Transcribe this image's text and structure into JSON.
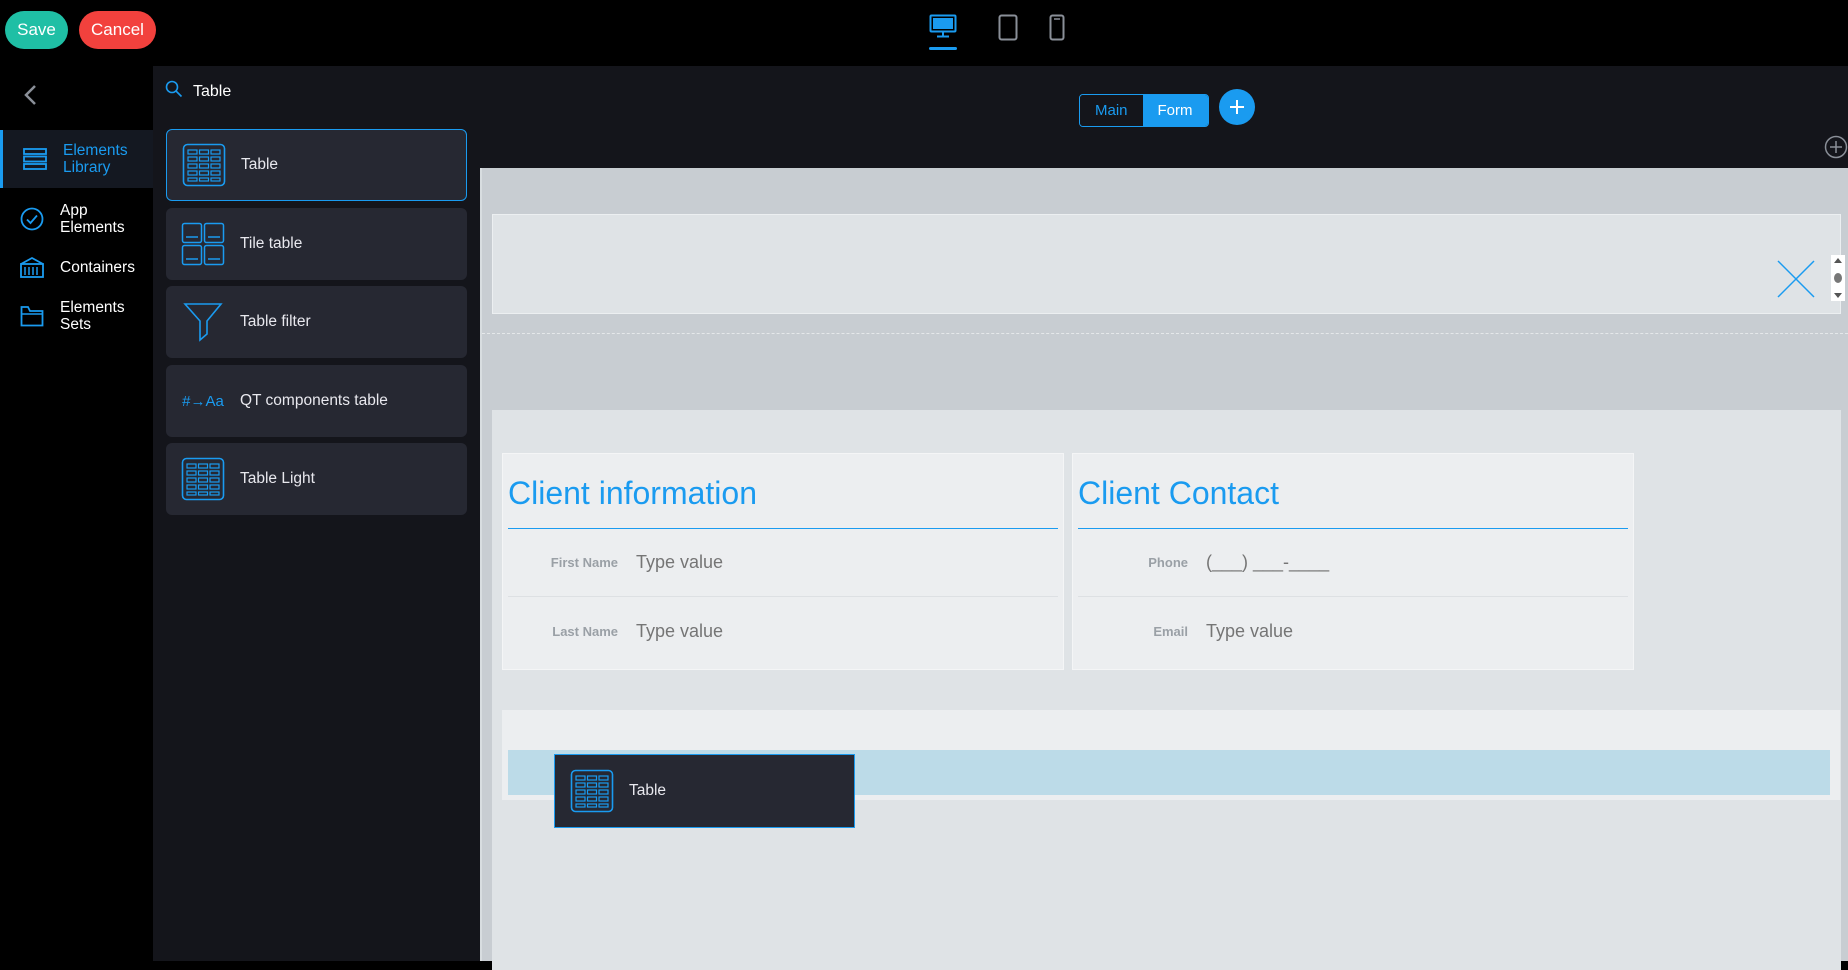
{
  "toolbar": {
    "save_label": "Save",
    "cancel_label": "Cancel"
  },
  "devices": [
    {
      "name": "desktop",
      "active": true
    },
    {
      "name": "tablet",
      "active": false
    },
    {
      "name": "phone",
      "active": false
    }
  ],
  "nav": {
    "items": [
      {
        "label": "Elements\nLibrary",
        "icon": "stack-icon",
        "active": true
      },
      {
        "label": "App\nElements",
        "icon": "check-circle-icon",
        "active": false
      },
      {
        "label": "Containers",
        "icon": "container-icon",
        "active": false
      },
      {
        "label": "Elements\nSets",
        "icon": "folder-icon",
        "active": false
      }
    ]
  },
  "library": {
    "search_value": "Table",
    "items": [
      {
        "label": "Table",
        "icon": "table-grid-icon",
        "selected": true
      },
      {
        "label": "Tile table",
        "icon": "tile-table-icon",
        "selected": false
      },
      {
        "label": "Table filter",
        "icon": "filter-icon",
        "selected": false
      },
      {
        "label": "QT components table",
        "icon": "hash-to-text-icon",
        "selected": false
      },
      {
        "label": "Table Light",
        "icon": "table-grid-icon",
        "selected": false
      }
    ]
  },
  "canvas": {
    "tabs": [
      {
        "label": "Main",
        "active": false
      },
      {
        "label": "Form",
        "active": true
      }
    ],
    "cards": [
      {
        "title": "Client information",
        "fields": [
          {
            "label": "First Name",
            "placeholder": "Type value"
          },
          {
            "label": "Last Name",
            "placeholder": "Type value"
          }
        ]
      },
      {
        "title": "Client Contact",
        "fields": [
          {
            "label": "Phone",
            "placeholder": "(___) ___-____"
          },
          {
            "label": "Email",
            "placeholder": "Type value"
          }
        ]
      }
    ],
    "drag_item": {
      "label": "Table",
      "icon": "table-grid-icon"
    }
  },
  "colors": {
    "accent": "#1a9bf0",
    "save": "#1fbfa5",
    "cancel": "#f2413d"
  }
}
